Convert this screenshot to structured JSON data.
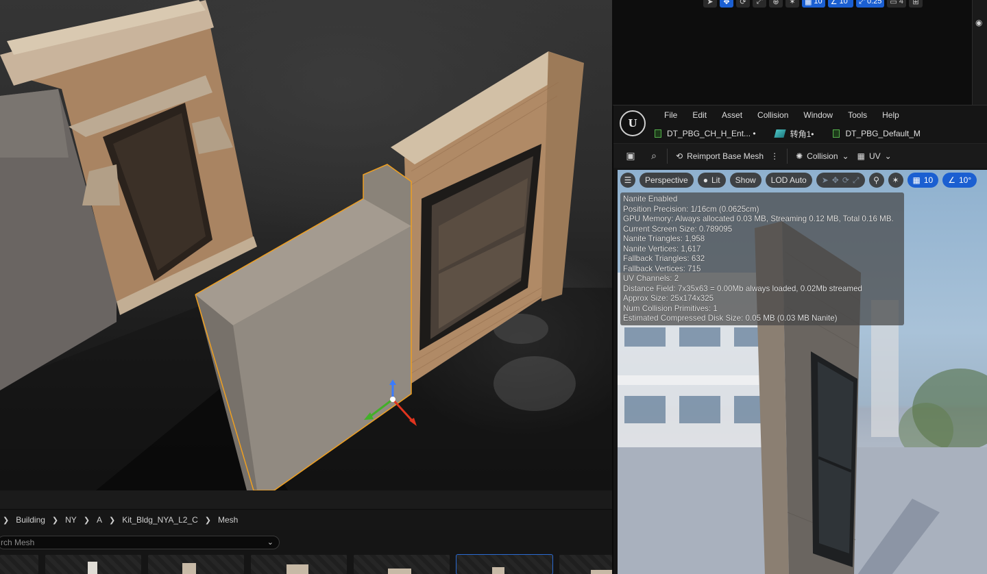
{
  "level_toolbar": {
    "grid_snap": "10",
    "rotation_snap": "10°",
    "scale_snap": "0.25",
    "camera_speed": "4"
  },
  "content_browser": {
    "breadcrumb": [
      "Building",
      "NY",
      "A",
      "Kit_Bldg_NYA_L2_C",
      "Mesh"
    ],
    "search_placeholder": "rch Mesh"
  },
  "mesh_editor": {
    "menu": [
      "File",
      "Edit",
      "Asset",
      "Collision",
      "Window",
      "Tools",
      "Help"
    ],
    "tabs": [
      {
        "label": "DT_PBG_CH_H_Ent... •",
        "icon": "blueprint-icon"
      },
      {
        "label": "转角1•",
        "icon": "static-mesh-icon"
      },
      {
        "label": "DT_PBG_Default_M",
        "icon": "blueprint-icon"
      }
    ],
    "toolbar": {
      "reimport": "Reimport Base Mesh",
      "collision": "Collision",
      "uv": "UV"
    },
    "viewport": {
      "perspective": "Perspective",
      "lit": "Lit",
      "show": "Show",
      "lod": "LOD Auto",
      "grid_snap": "10",
      "rotation_snap": "10°"
    },
    "stats": [
      "Nanite Enabled",
      "Position Precision: 1/16cm (0.0625cm)",
      "GPU Memory: Always allocated 0.03 MB, Streaming 0.12 MB, Total 0.16 MB.",
      "Current Screen Size: 0.789095",
      "Nanite Triangles: 1,958",
      "Nanite Vertices: 1,617",
      "Fallback Triangles: 632",
      "Fallback Vertices: 715",
      "UV Channels: 2",
      "Distance Field: 7x35x63 = 0.00Mb always loaded, 0.02Mb streamed",
      "Approx Size: 25x174x325",
      "Num Collision Primitives: 1",
      "Estimated Compressed Disk Size: 0.05 MB (0.03 MB Nanite)"
    ]
  },
  "colors": {
    "accent_blue": "#1b5fd1",
    "selection_orange": "#f0a020",
    "brick": "#b08a66"
  }
}
